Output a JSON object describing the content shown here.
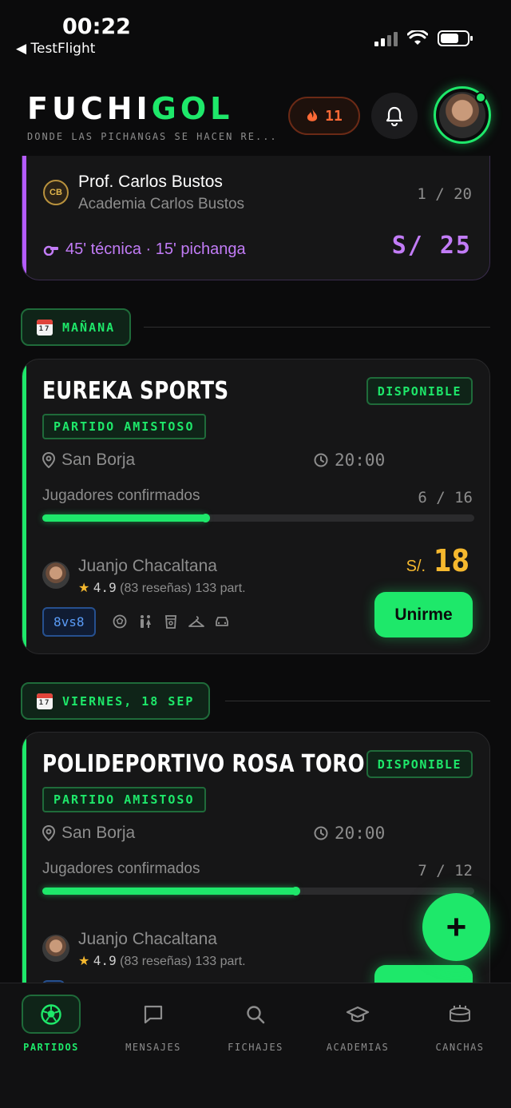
{
  "status_bar": {
    "time": "00:22",
    "back_label": "TestFlight"
  },
  "header": {
    "logo_white": "FUCHI",
    "logo_green": "GOL",
    "tagline": "DONDE LAS PICHANGAS SE HACEN RE...",
    "streak_count": "11"
  },
  "academy_card": {
    "badge": "CB",
    "coach": "Prof. Carlos Bustos",
    "academy": "Academia Carlos Bustos",
    "count": "1 / 20",
    "format": "45' técnica · 15' pichanga",
    "price": "S/ 25",
    "accent_color": "#b45cff"
  },
  "sections": [
    {
      "date_chip": {
        "icon_day": "17",
        "label": "MAÑANA"
      },
      "match": {
        "venue": "EUREKA SPORTS",
        "status": "DISPONIBLE",
        "type": "PARTIDO AMISTOSO",
        "location": "San Borja",
        "time": "20:00",
        "players_label": "Jugadores confirmados",
        "players_count": "6 / 16",
        "players_fraction": 0.38,
        "host_name": "Juanjo Chacaltana",
        "host_rating": "4.9",
        "host_reviews": "(83 reseñas)",
        "host_matches": "133 part.",
        "currency": "S/.",
        "price": "18",
        "format": "8vs8",
        "amenities": [
          "ball-icon",
          "restroom-icon",
          "drink-icon",
          "hanger-icon",
          "parking-icon"
        ],
        "join_label": "Unirme"
      }
    },
    {
      "date_chip": {
        "icon_day": "17",
        "label": "VIERNES, 18 SEP"
      },
      "match": {
        "venue": "POLIDEPORTIVO ROSA TORO",
        "status": "DISPONIBLE",
        "type": "PARTIDO AMISTOSO",
        "location": "San Borja",
        "time": "20:00",
        "players_label": "Jugadores confirmados",
        "players_count": "7 / 12",
        "players_fraction": 0.59,
        "host_name": "Juanjo Chacaltana",
        "host_rating": "4.9",
        "host_reviews": "(83 reseñas)",
        "host_matches": "133 part."
      }
    }
  ],
  "fab": {
    "label": "+"
  },
  "bottom_nav": [
    {
      "label": "PARTIDOS",
      "icon": "soccer-ball-icon",
      "active": true
    },
    {
      "label": "MENSAJES",
      "icon": "chat-icon",
      "active": false
    },
    {
      "label": "FICHAJES",
      "icon": "search-icon",
      "active": false
    },
    {
      "label": "ACADEMIAS",
      "icon": "graduation-cap-icon",
      "active": false
    },
    {
      "label": "CANCHAS",
      "icon": "stadium-icon",
      "active": false
    }
  ],
  "colors": {
    "accent": "#1ee86a",
    "price": "#f5b82e",
    "purple": "#c27cf7",
    "streak": "#ff6a36"
  }
}
